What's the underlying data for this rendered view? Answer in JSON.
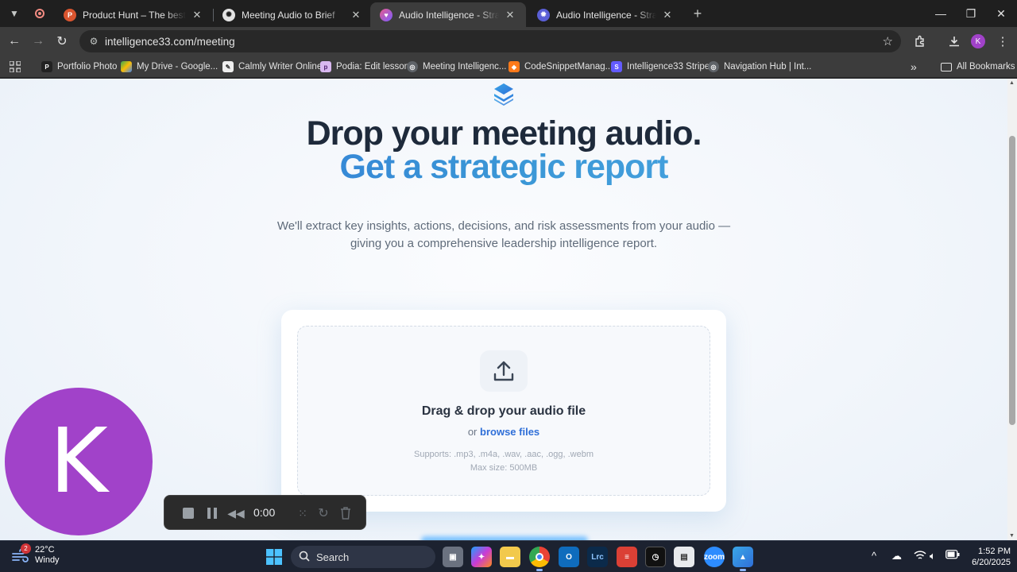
{
  "browser": {
    "tabs": [
      {
        "title": "Product Hunt – The best new products",
        "favicon": "P",
        "active": false
      },
      {
        "title": "Meeting Audio to Brief",
        "favicon": "openai",
        "active": false
      },
      {
        "title": "Audio Intelligence - Strategic Clarity",
        "favicon": "heart",
        "active": true
      },
      {
        "title": "Audio Intelligence - Strategic Clarity",
        "favicon": "gear",
        "active": false
      }
    ],
    "new_tab": "+",
    "url": "intelligence33.com/meeting",
    "profile_initial": "K"
  },
  "bookmarks": {
    "items": [
      {
        "label": "Portfolio Photo"
      },
      {
        "label": "My Drive - Google..."
      },
      {
        "label": "Calmly Writer Online"
      },
      {
        "label": "Podia: Edit lesson"
      },
      {
        "label": "Meeting Intelligenc..."
      },
      {
        "label": "CodeSnippetManag..."
      },
      {
        "label": "Intelligence33 Stripe"
      },
      {
        "label": "Navigation Hub | Int..."
      }
    ],
    "overflow": "»",
    "all_bookmarks": "All Bookmarks"
  },
  "hero": {
    "line1": "Drop your meeting audio.",
    "line2": "Get a strategic report",
    "subtext": "We'll extract key insights, actions, decisions, and risk assessments from your audio — giving you a comprehensive leadership intelligence report."
  },
  "upload": {
    "title": "Drag & drop your audio file",
    "or_text": "or",
    "browse": "browse files",
    "supports": "Supports: .mp3, .m4a, .wav, .aac, .ogg, .webm",
    "max_size": "Max size: 500MB"
  },
  "overlay": {
    "avatar_initial": "K",
    "recorder_time": "0:00"
  },
  "taskbar": {
    "temperature": "22°C",
    "condition": "Windy",
    "weather_badge": "2",
    "search": "Search",
    "time": "1:52 PM",
    "date": "6/20/2025"
  },
  "colors": {
    "accent": "#2f6fd8",
    "accent_light": "#55b1e8",
    "heading": "#1e2a3b",
    "avatar": "#a142c9"
  }
}
